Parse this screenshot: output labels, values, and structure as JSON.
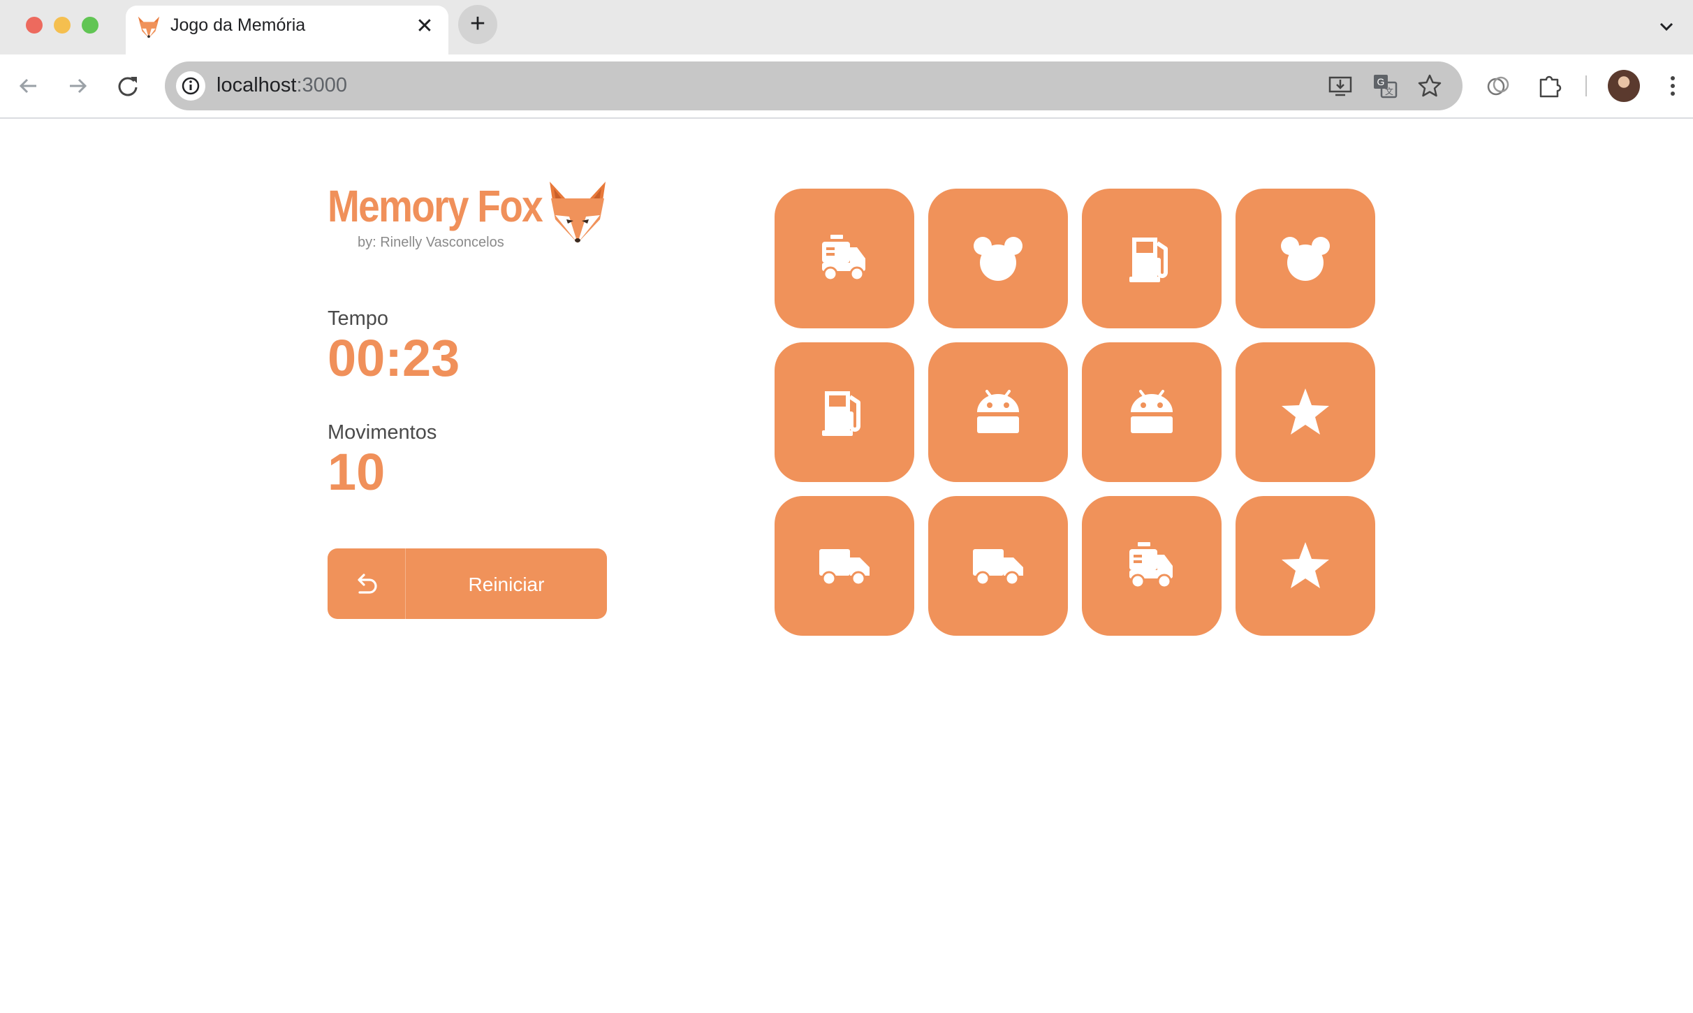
{
  "browser": {
    "tab_title": "Jogo da Memória",
    "tab_favicon": "fox-icon",
    "url_host": "localhost",
    "url_port": ":3000"
  },
  "app": {
    "logo_text": "Memory Fox",
    "logo_byline": "by: Rinelly Vasconcelos",
    "time_label": "Tempo",
    "time_value": "00:23",
    "moves_label": "Movimentos",
    "moves_value": "10",
    "restart_label": "Reiniciar",
    "accent_color": "#f0925a"
  },
  "cards": [
    {
      "icon": "tanker-truck-icon"
    },
    {
      "icon": "mouse-ears-icon"
    },
    {
      "icon": "gas-pump-icon"
    },
    {
      "icon": "mouse-ears-icon"
    },
    {
      "icon": "gas-pump-icon"
    },
    {
      "icon": "android-icon"
    },
    {
      "icon": "android-icon"
    },
    {
      "icon": "star-icon"
    },
    {
      "icon": "delivery-truck-icon"
    },
    {
      "icon": "delivery-truck-icon"
    },
    {
      "icon": "tanker-truck-icon"
    },
    {
      "icon": "star-icon"
    }
  ]
}
